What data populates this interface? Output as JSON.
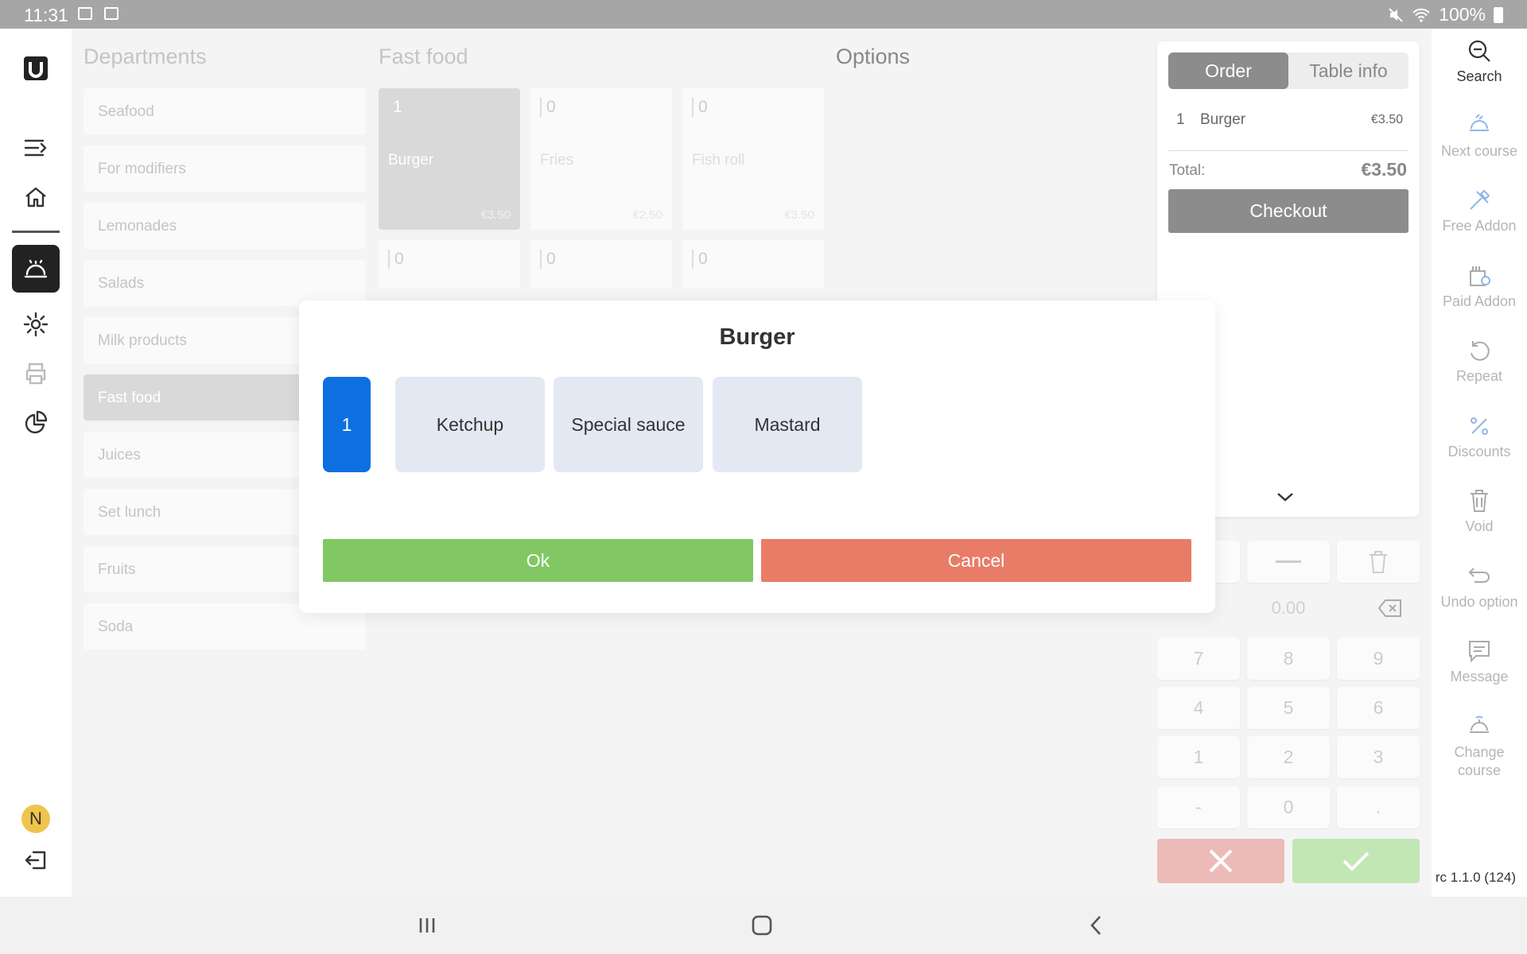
{
  "status_bar": {
    "time": "11:31",
    "battery": "100%"
  },
  "departments": {
    "title": "Departments",
    "items": [
      "Seafood",
      "For modifiers",
      "Lemonades",
      "Salads",
      "Milk products",
      "Fast food",
      "Juices",
      "Set lunch",
      "Fruits",
      "Soda"
    ],
    "selected": "Fast food"
  },
  "products": {
    "title": "Fast food",
    "tiles": [
      {
        "count": "1",
        "name": "Burger",
        "price": "€3.50"
      },
      {
        "count": "0",
        "name": "Fries",
        "price": "€2.50"
      },
      {
        "count": "0",
        "name": "Fish roll",
        "price": "€3.50"
      },
      {
        "count": "0",
        "name": "",
        "price": ""
      },
      {
        "count": "0",
        "name": "",
        "price": ""
      },
      {
        "count": "0",
        "name": "",
        "price": ""
      }
    ]
  },
  "options": {
    "title": "Options"
  },
  "order_panel": {
    "tabs": [
      "Order",
      "Table info"
    ],
    "active_tab": "Order",
    "lines": [
      {
        "qty": "1",
        "name": "Burger",
        "price": "€3.50"
      }
    ],
    "total_label": "Total:",
    "total_value": "€3.50",
    "checkout_label": "Checkout"
  },
  "keypad": {
    "amount": "0.00",
    "keys": [
      "7",
      "8",
      "9",
      "4",
      "5",
      "6",
      "1",
      "2",
      "3",
      "-",
      "0",
      "."
    ]
  },
  "actions": {
    "search": "Search",
    "next_course": "Next course",
    "free_addon": "Free Addon",
    "paid_addon": "Paid Addon",
    "repeat": "Repeat",
    "discounts": "Discounts",
    "void": "Void",
    "undo_option": "Undo option",
    "message": "Message",
    "change_course": "Change course"
  },
  "version": "rc 1.1.0 (124)",
  "user": {
    "initial": "N",
    "avatar_color": "#f0c44c"
  },
  "modal": {
    "title": "Burger",
    "quantity": "1",
    "modifiers": [
      "Ketchup",
      "Special sauce",
      "Mastard"
    ],
    "ok_label": "Ok",
    "cancel_label": "Cancel",
    "ok_color": "#81c864",
    "cancel_color": "#e97c67",
    "accent_color": "#0d6fe0"
  }
}
